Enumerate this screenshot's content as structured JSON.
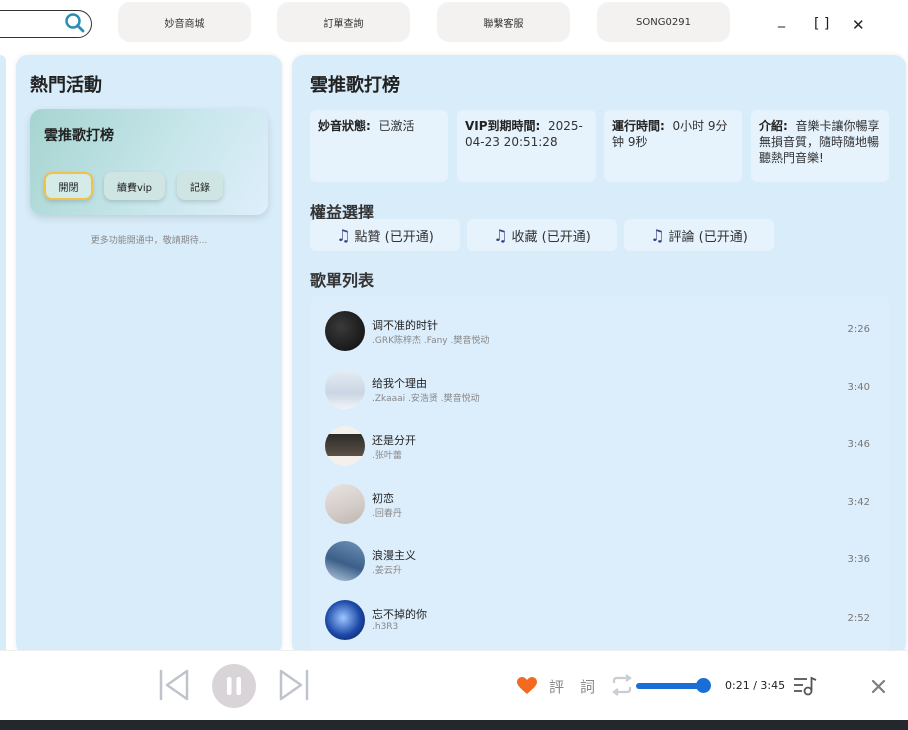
{
  "header": {
    "tabs": [
      "妙音商城",
      "訂單查詢",
      "聯繫客服",
      "SONG0291"
    ],
    "window": {
      "minimize": "_",
      "maximize": "[ ]",
      "close": "✕"
    }
  },
  "left_panel": {
    "title": "熱門活動",
    "card": {
      "title": "雲推歌打榜",
      "buttons": [
        "開閉",
        "續費vip",
        "記錄"
      ]
    },
    "more_text": "更多功能開通中，敬請期待..."
  },
  "right_panel": {
    "title": "雲推歌打榜",
    "info": {
      "status_label": "妙音狀態:",
      "status_value": "已激活",
      "vip_label": "VIP到期時間:",
      "vip_value": "2025-04-23 20:51:28",
      "run_label": "運行時間:",
      "run_value": "0小时 9分钟 9秒",
      "intro_label": "介紹:",
      "intro_value": "音樂卡讓你暢享無損音質，隨時隨地暢聽熱門音樂!"
    },
    "perm_title": "權益選擇",
    "perms": [
      "點贊 (已开通)",
      "收藏 (已开通)",
      "評論 (已开通)"
    ],
    "list_title": "歌單列表",
    "songs": [
      {
        "title": "调不准的时针",
        "artist": ".GRK陈梓杰 .Fany .樊音悦动",
        "duration": "2:26"
      },
      {
        "title": "给我个理由",
        "artist": ".Zkaaai .安浩贤 .樊音悦动",
        "duration": "3:40"
      },
      {
        "title": "还是分开",
        "artist": ".张叶蕾",
        "duration": "3:46"
      },
      {
        "title": "初恋",
        "artist": ".回春丹",
        "duration": "3:42"
      },
      {
        "title": "浪漫主义",
        "artist": ".姜云升",
        "duration": "3:36"
      },
      {
        "title": "忘不掉的你",
        "artist": ".h3R3",
        "duration": "2:52"
      }
    ]
  },
  "player": {
    "comment": "評",
    "lyrics": "詞",
    "time": "0:21 / 3:45",
    "progress": 0.93
  },
  "colors": {
    "accent": "#1a6fd6",
    "heart": "#f26a21",
    "panel": "#d8ecfa"
  }
}
